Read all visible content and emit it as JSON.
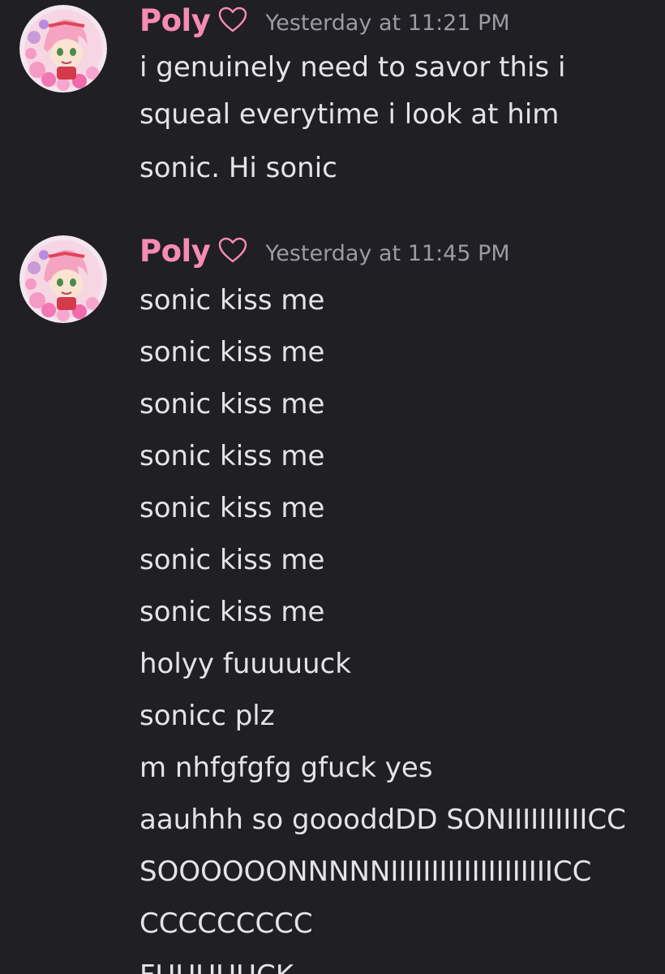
{
  "messages": [
    {
      "username": "Poly",
      "timestamp": "Yesterday at 11:21 PM",
      "lines": [
        "i genuinely need to savor this i",
        "squeal everytime i look at him",
        "sonic. Hi sonic"
      ]
    },
    {
      "username": "Poly",
      "timestamp": "Yesterday at 11:45 PM",
      "lines": [
        "sonic kiss me",
        "sonic kiss me",
        "sonic kiss me",
        "sonic kiss me",
        "sonic kiss me",
        "sonic kiss me",
        "sonic kiss me",
        "holyy fuuuuuck",
        "sonicc plz",
        "m nhfgfgfg gfuck yes",
        "aauhhh so goooddDD SONIIIIIIIIIICC",
        "SOOOOOONNNNNIIIIIIIIIIIIIIIIIIIICC",
        "CCCCCCCCC",
        "FUUUUUCK"
      ]
    }
  ],
  "colors": {
    "background": "#1f1f24",
    "username": "#f78bb2",
    "timestamp": "#9a9ba4",
    "text": "#e4e4e8"
  },
  "icons": {
    "heart": "heart-outline-icon",
    "avatar": "avatar-image"
  }
}
